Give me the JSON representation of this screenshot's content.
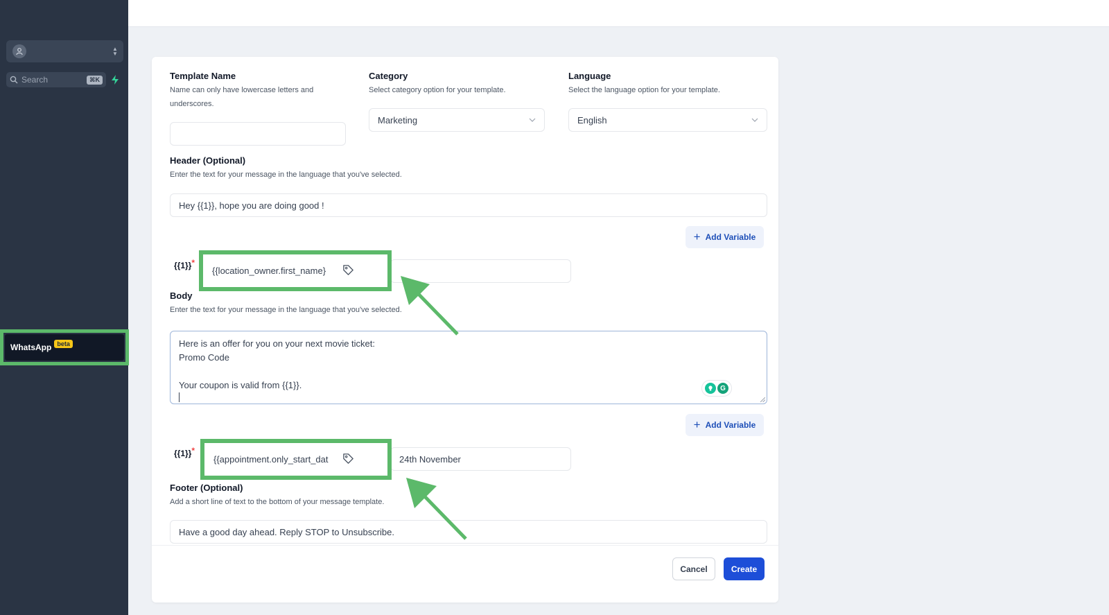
{
  "sidebar": {
    "search_placeholder": "Search",
    "search_shortcut": "⌘K",
    "whatsapp_label": "WhatsApp",
    "whatsapp_badge": "beta"
  },
  "form": {
    "template_name": {
      "label": "Template Name",
      "hint": "Name can only have lowercase letters and underscores.",
      "value": ""
    },
    "category": {
      "label": "Category",
      "hint": "Select category option for your template.",
      "value": "Marketing"
    },
    "language": {
      "label": "Language",
      "hint": "Select the language option for your template.",
      "value": "English"
    },
    "header": {
      "label": "Header (Optional)",
      "hint": "Enter the text for your message in the language that you've selected.",
      "value": "Hey {{1}}, hope you are doing good !",
      "add_variable": "Add Variable",
      "variable_label": "{{1}}",
      "variable_required": "*",
      "variable_field": "{{location_owner.first_name}",
      "sample_value": ""
    },
    "body": {
      "label": "Body",
      "hint": "Enter the text for your message in the language that you've selected.",
      "lines": [
        "Here is an offer for you on your next movie ticket:",
        "Promo Code",
        "",
        "Your coupon is valid from {{1}}."
      ],
      "add_variable": "Add Variable",
      "variable_label": "{{1}}",
      "variable_required": "*",
      "variable_field": "{{appointment.only_start_dat",
      "sample_value": "24th November"
    },
    "footer": {
      "label": "Footer (Optional)",
      "hint": "Add a short line of text to the bottom of your message template.",
      "value": "Have a good day ahead. Reply STOP to Unsubscribe."
    },
    "actions": {
      "cancel": "Cancel",
      "create": "Create"
    }
  },
  "colors": {
    "highlight": "#5cb96a",
    "primary": "#1d4ed8",
    "sidebar": "#2a3444"
  }
}
